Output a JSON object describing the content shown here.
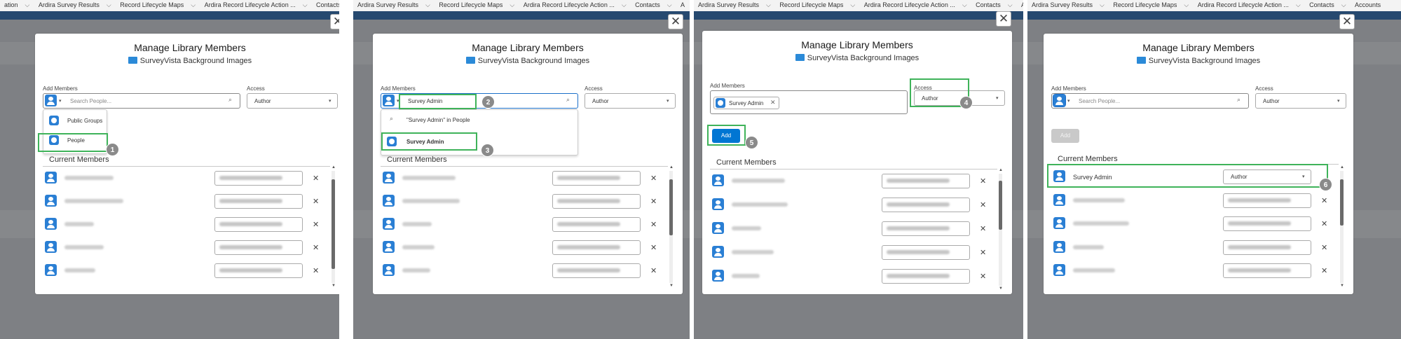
{
  "nav": {
    "p1": [
      "ation",
      "Ardira Survey Results",
      "Record Lifecycle Maps",
      "Ardira Record Lifecycle Action ...",
      "Contacts",
      "Ac"
    ],
    "p2": [
      "Ardira Survey Results",
      "Record Lifecycle Maps",
      "Ardira Record Lifecycle Action ...",
      "Contacts",
      "A"
    ],
    "p3": [
      "Ardira Survey Results",
      "Record Lifecycle Maps",
      "Ardira Record Lifecycle Action ...",
      "Contacts",
      "Accou"
    ],
    "p4": [
      "Ardira Survey Results",
      "Record Lifecycle Maps",
      "Ardira Record Lifecycle Action ...",
      "Contacts",
      "Accounts"
    ]
  },
  "modal": {
    "title": "Manage Library Members",
    "library": "SurveyVista Background Images",
    "add_members_label": "Add Members",
    "access_label": "Access",
    "search_placeholder": "Search People...",
    "access_value": "Author",
    "current_members": "Current Members",
    "add_button": "Add"
  },
  "step1": {
    "dropdown": [
      "Public Groups",
      "People"
    ]
  },
  "step2": {
    "search_value": "Survey Admin",
    "suggestion": "\"Survey Admin\" in People",
    "result": "Survey Admin"
  },
  "step3": {
    "pill": "Survey Admin"
  },
  "step4": {
    "new_member": "Survey Admin",
    "new_member_access": "Author"
  },
  "badges": [
    "1",
    "2",
    "3",
    "4",
    "5",
    "6"
  ],
  "colors": {
    "highlight": "#3fb35a",
    "brand_blue": "#0176d3",
    "nav_stripe": "#26496f"
  }
}
